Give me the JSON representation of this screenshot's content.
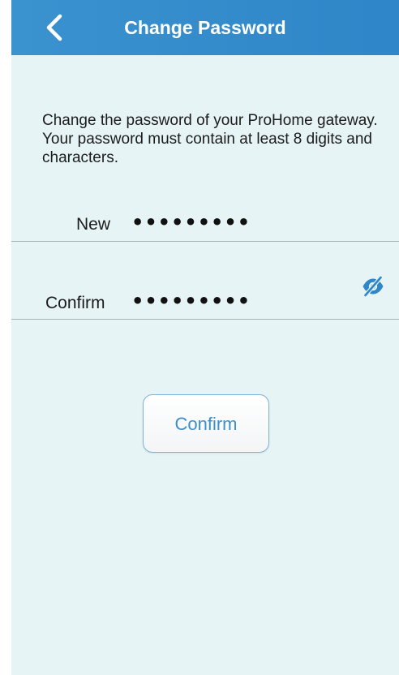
{
  "navbar": {
    "title": "Change Password",
    "back_icon": "chevron-left-icon",
    "background_color": "#3a92cf"
  },
  "description": "Change the password of your ProHome gateway. Your password must contain at least 8 digits and characters.",
  "fields": {
    "new": {
      "label": "New",
      "value": "secretpw1"
    },
    "confirm": {
      "label": "Confirm",
      "value": "secretpw1"
    }
  },
  "visibility_toggle": {
    "icon": "eye-slash-icon",
    "color": "#2f86c8"
  },
  "confirm_button": {
    "label": "Confirm",
    "text_color": "#3d8fcb"
  },
  "background_color": "#e6f4f5"
}
